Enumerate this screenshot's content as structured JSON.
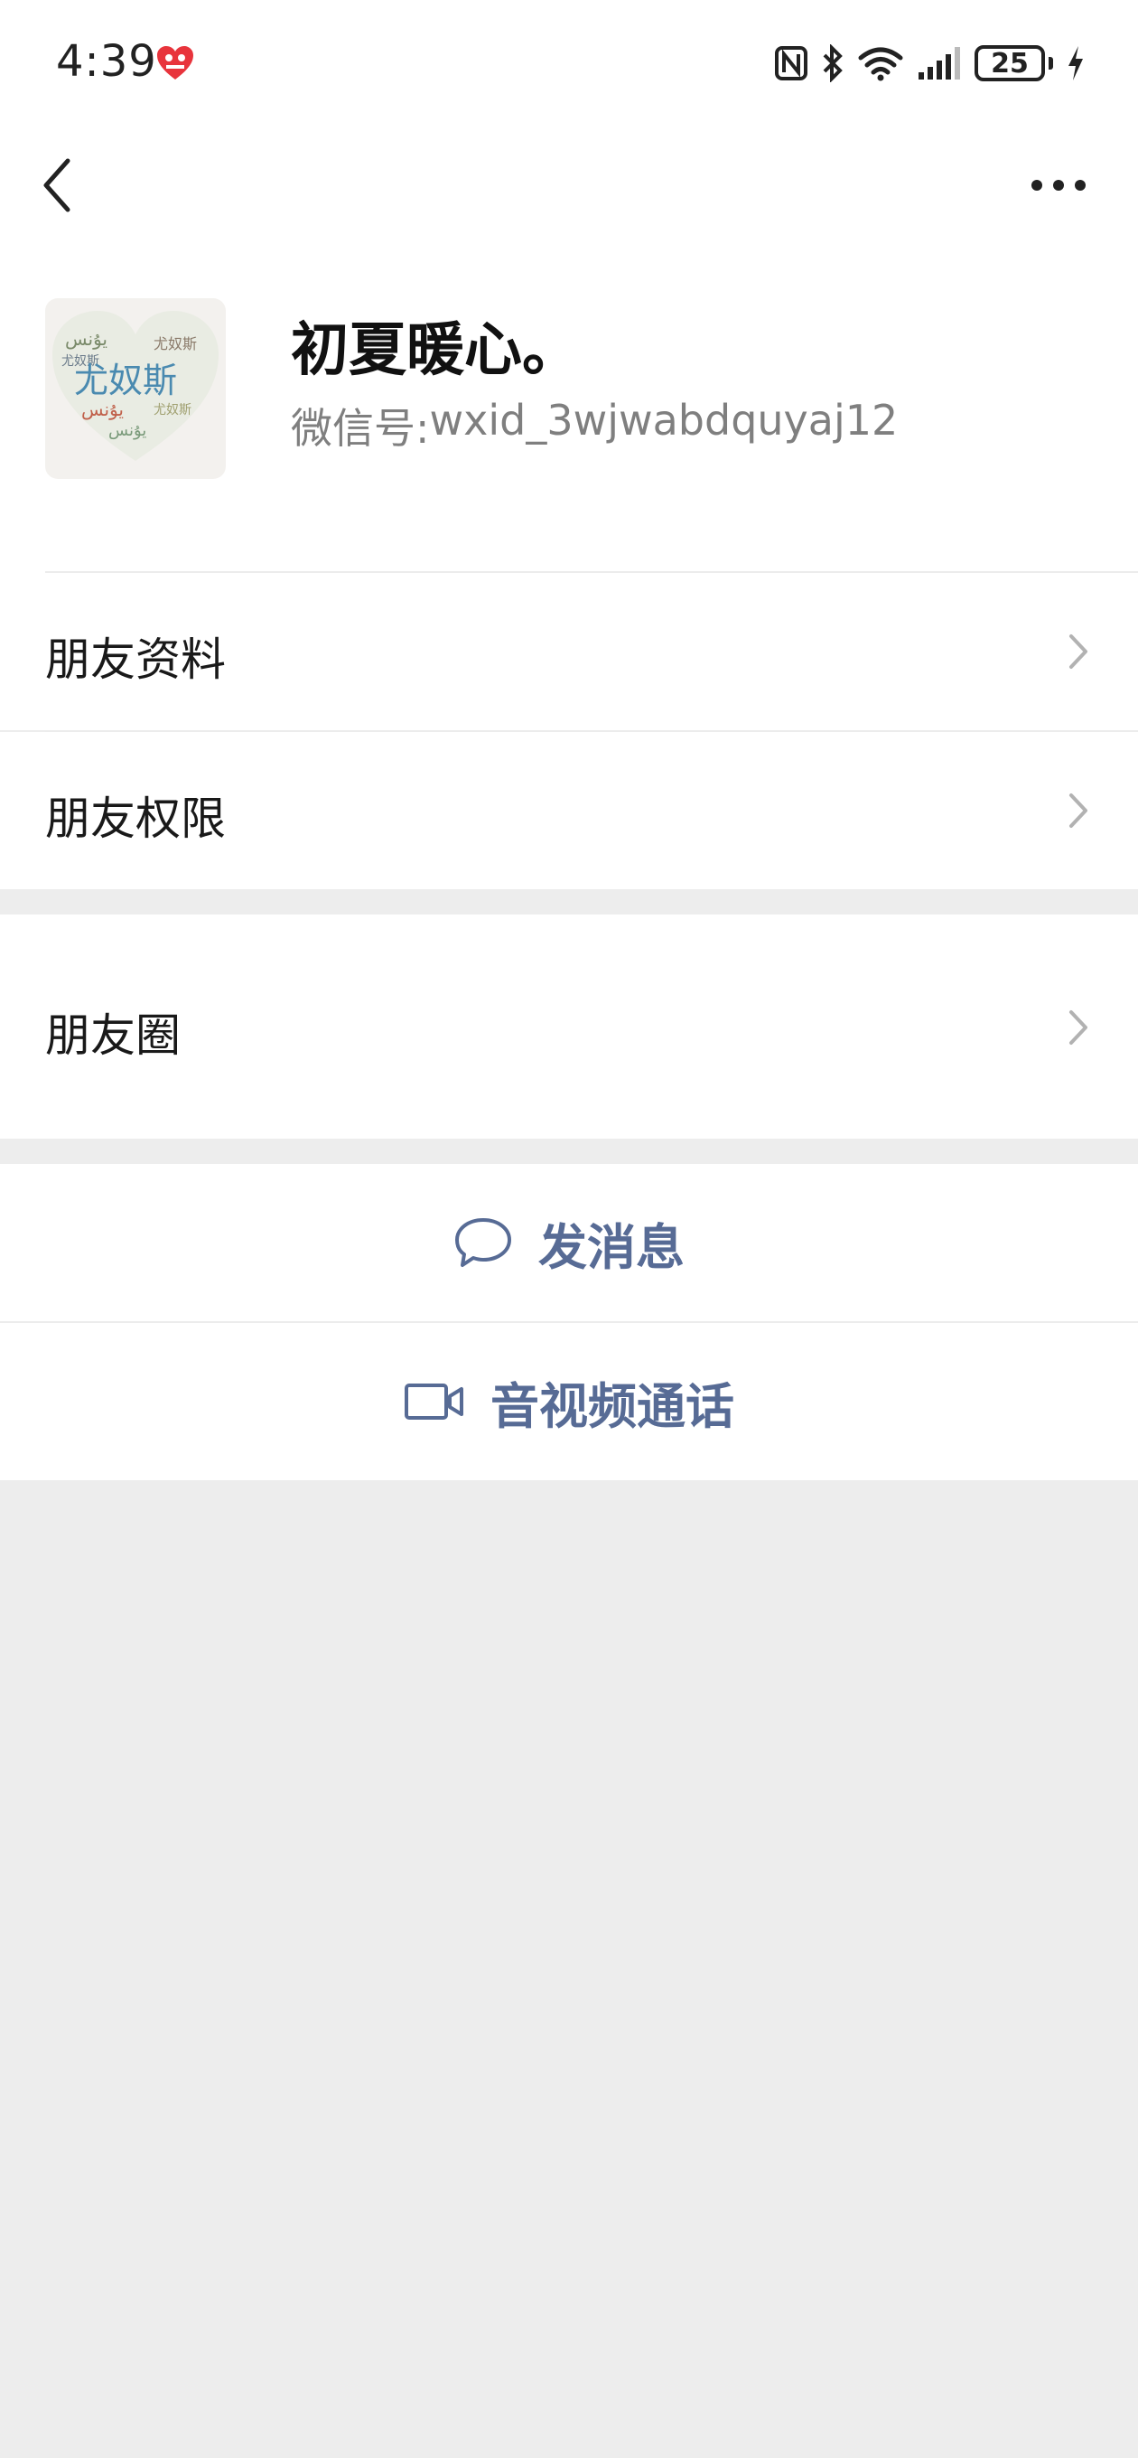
{
  "status_bar": {
    "time": "4:39",
    "battery": "25"
  },
  "profile": {
    "avatar_text": "尤奴斯",
    "name": "初夏暖心。",
    "wechat_id_label": "微信号:",
    "wechat_id": "wxid_3wjwabdquyaj12"
  },
  "menu": {
    "friend_info": "朋友资料",
    "friend_permissions": "朋友权限",
    "moments": "朋友圈"
  },
  "actions": {
    "send_message": "发消息",
    "video_call": "音视频通话"
  },
  "colors": {
    "link_blue": "#576b95",
    "background": "#ededed"
  }
}
